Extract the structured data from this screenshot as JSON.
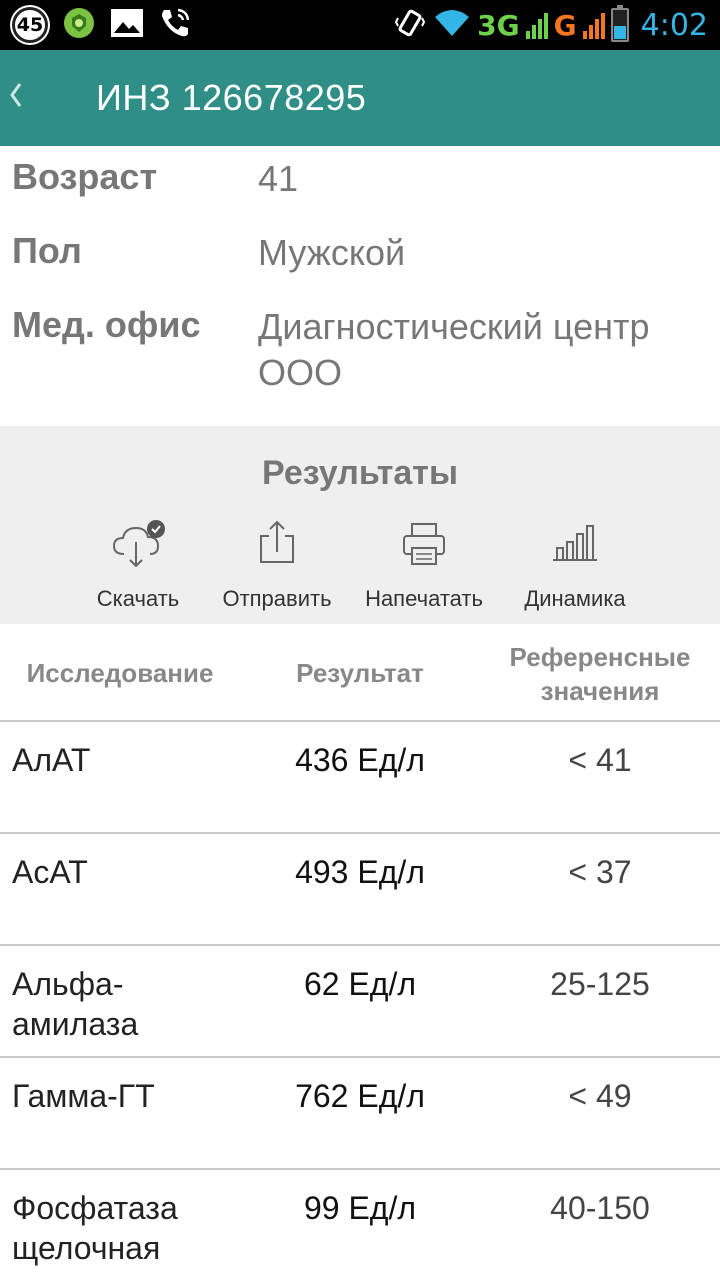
{
  "status_bar": {
    "notification_count": "45",
    "network_3g": "3G",
    "network_g": "G",
    "time": "4:02",
    "battery_level": 0.45
  },
  "header": {
    "back_icon": "chevron-left-icon",
    "title": "ИНЗ 126678295"
  },
  "patient": {
    "age_label": "Возраст",
    "age_value": "41",
    "sex_label": "Пол",
    "sex_value": "Мужской",
    "office_label": "Мед. офис",
    "office_value": "Диагностический центр ООО"
  },
  "results": {
    "title": "Результаты",
    "actions": [
      {
        "label": "Скачать",
        "icon": "cloud-download-check-icon"
      },
      {
        "label": "Отправить",
        "icon": "share-icon"
      },
      {
        "label": "Напечатать",
        "icon": "printer-icon"
      },
      {
        "label": "Динамика",
        "icon": "bar-chart-icon"
      }
    ]
  },
  "table": {
    "headers": {
      "study": "Исследование",
      "result": "Результат",
      "reference": "Референсные значения"
    },
    "rows": [
      {
        "study": "АлАТ",
        "result": "436 Ед/л",
        "reference": "< 41"
      },
      {
        "study": "АсАТ",
        "result": "493 Ед/л",
        "reference": "< 37"
      },
      {
        "study": "Альфа-амилаза",
        "result": "62 Ед/л",
        "reference": "25-125"
      },
      {
        "study": "Гамма-ГТ",
        "result": "762 Ед/л",
        "reference": "< 49"
      },
      {
        "study": "Фосфатаза щелочная",
        "result": "99 Ед/л",
        "reference": "40-150"
      }
    ]
  },
  "colors": {
    "app_bar": "#2f8f87",
    "status_time": "#33b5e5",
    "network_3g": "#6dd24a",
    "network_g": "#f3771e"
  }
}
